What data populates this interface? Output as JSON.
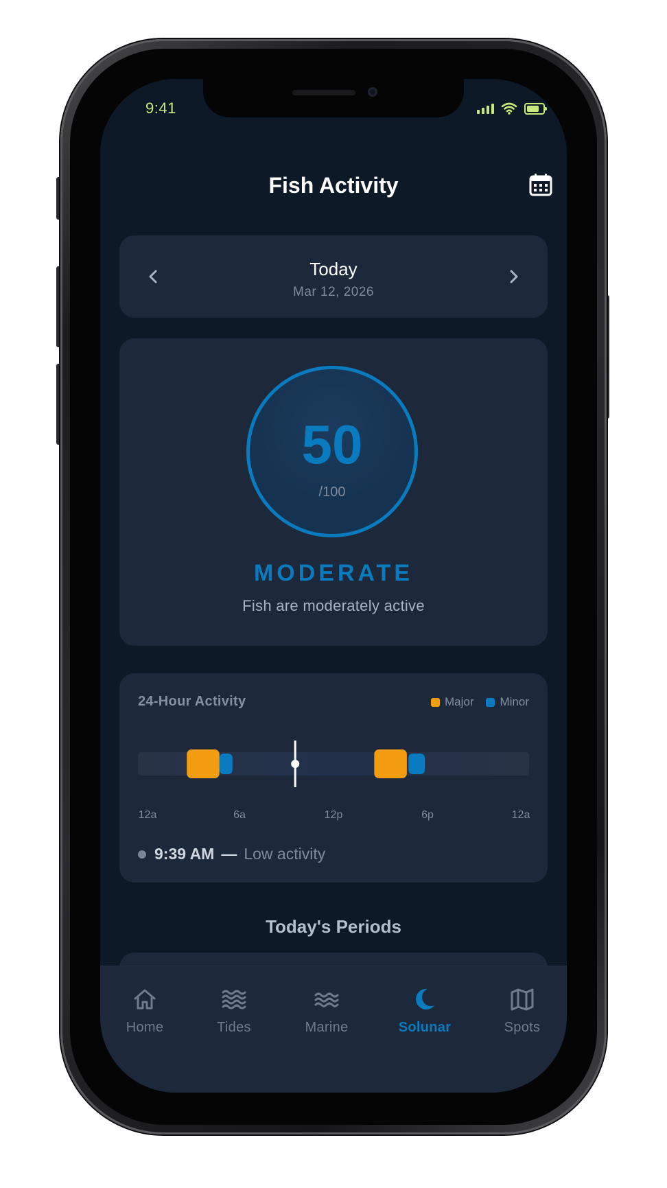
{
  "status_bar": {
    "time": "9:41"
  },
  "header": {
    "title": "Fish Activity",
    "calendar_icon": "calendar-icon"
  },
  "date_selector": {
    "label": "Today",
    "date": "Mar 12, 2026"
  },
  "score": {
    "value": "50",
    "max": "/100",
    "level": "MODERATE",
    "description": "Fish are moderately active",
    "progress": 0.5
  },
  "activity": {
    "title": "24-Hour Activity",
    "legend": [
      {
        "label": "Major",
        "color": "#f39c12"
      },
      {
        "label": "Minor",
        "color": "#0a7bbf"
      }
    ],
    "ticks": [
      "12a",
      "6a",
      "12p",
      "6p",
      "12a"
    ],
    "major_periods_hours": [
      [
        3.0,
        5.0
      ],
      [
        14.5,
        16.5
      ]
    ],
    "minor_periods_hours": [
      [
        5.0,
        5.8
      ],
      [
        16.6,
        17.6
      ]
    ],
    "current_hour": 9.65,
    "now": {
      "time": "9:39 AM",
      "dash": "—",
      "label": "Low activity"
    }
  },
  "periods": {
    "title": "Today's Periods"
  },
  "tabbar": {
    "items": [
      {
        "label": "Home",
        "icon": "home-icon"
      },
      {
        "label": "Tides",
        "icon": "waves-icon"
      },
      {
        "label": "Marine",
        "icon": "water-icon"
      },
      {
        "label": "Solunar",
        "icon": "moon-icon",
        "active": true
      },
      {
        "label": "Spots",
        "icon": "map-icon"
      }
    ]
  },
  "colors": {
    "accent": "#0a7bbf",
    "major": "#f39c12",
    "background": "#0e1928",
    "card": "#1d293a"
  }
}
